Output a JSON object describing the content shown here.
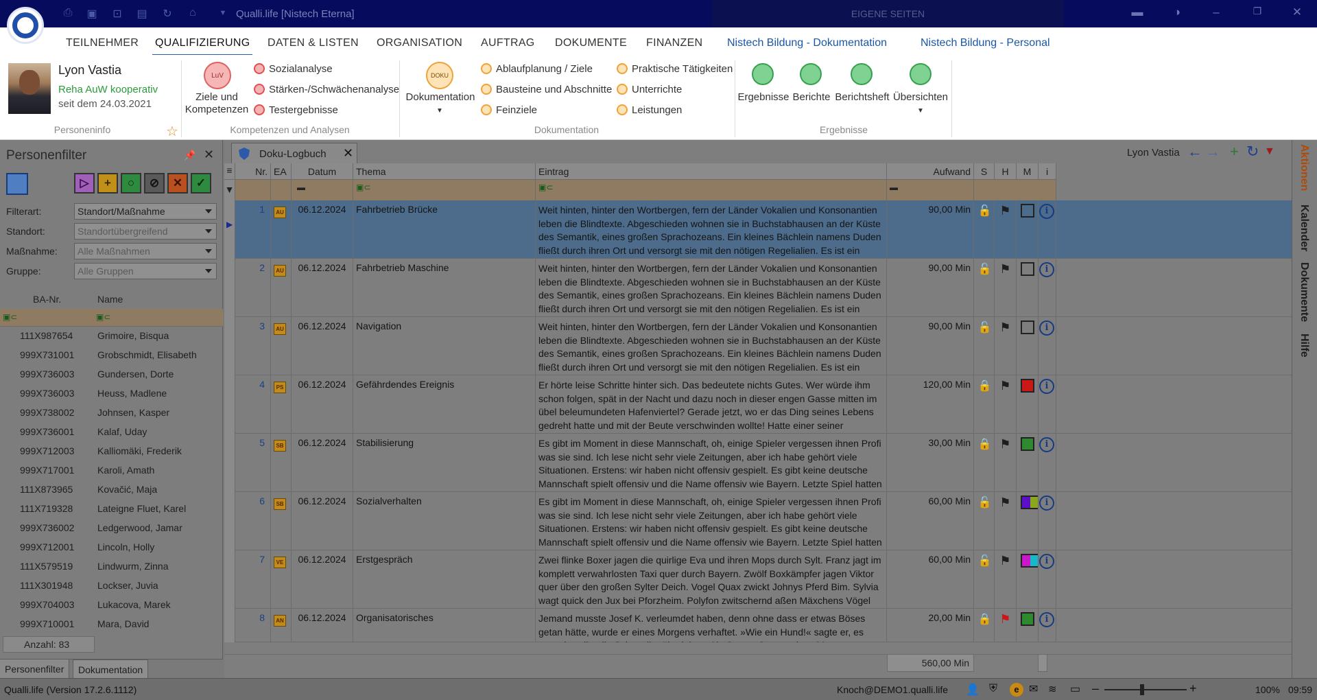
{
  "titlebar": {
    "app_title": "Qualli.life [Nistech Eterna]",
    "own_pages": "EIGENE SEITEN",
    "quick_access_icons": [
      "print-icon",
      "save-icon",
      "lock-icon",
      "document-settings-icon",
      "refresh-icon",
      "home-icon",
      "dropdown-icon"
    ],
    "window_buttons": [
      "layout-icon",
      "contrast-icon",
      "minimize-icon",
      "restore-icon",
      "close-icon"
    ]
  },
  "menu": {
    "items": [
      "TEILNEHMER",
      "QUALIFIZIERUNG",
      "DATEN & LISTEN",
      "ORGANISATION",
      "AUFTRAG",
      "DOKUMENTE",
      "FINANZEN"
    ],
    "links": [
      "Nistech Bildung - Dokumentation",
      "Nistech Bildung - Personal"
    ],
    "active": "QUALIFIZIERUNG"
  },
  "ribbon": {
    "person": {
      "name": "Lyon Vastia",
      "group": "Reha AuW kooperativ",
      "since": "seit dem 24.03.2021",
      "section_label": "Personeninfo"
    },
    "competences": {
      "badge": "LuV",
      "big_label_1": "Ziele und",
      "big_label_2": "Kompetenzen",
      "items": [
        "Sozialanalyse",
        "Stärken-/Schwächenanalyse",
        "Testergebnisse"
      ],
      "section_label": "Kompetenzen und Analysen"
    },
    "documentation": {
      "badge": "DOKU",
      "big_label": "Dokumentation",
      "items_col1": [
        "Ablaufplanung / Ziele",
        "Bausteine und Abschnitte",
        "Feinziele"
      ],
      "items_col2": [
        "Praktische Tätigkeiten",
        "Unterrichte",
        "Leistungen"
      ],
      "section_label": "Dokumentation"
    },
    "results": {
      "items": [
        "Ergebnisse",
        "Berichte",
        "Berichtsheft",
        "Übersichten"
      ],
      "section_label": "Ergebnisse"
    }
  },
  "left_panel": {
    "title": "Personenfilter",
    "filters": [
      {
        "label": "Filterart:",
        "value": "Standort/Maßnahme"
      },
      {
        "label": "Standort:",
        "value": "Standortübergreifend"
      },
      {
        "label": "Maßnahme:",
        "value": "Alle Maßnahmen"
      },
      {
        "label": "Gruppe:",
        "value": "Alle Gruppen"
      }
    ],
    "columns": [
      "BA-Nr.",
      "Name"
    ],
    "rows": [
      {
        "ba": "111X987654",
        "name": "Grimoire, Bisqua"
      },
      {
        "ba": "999X731001",
        "name": "Grobschmidt, Elisabeth"
      },
      {
        "ba": "999X736003",
        "name": "Gundersen, Dorte"
      },
      {
        "ba": "999X736003",
        "name": "Heuss, Madlene"
      },
      {
        "ba": "999X738002",
        "name": "Johnsen, Kasper"
      },
      {
        "ba": "999X736001",
        "name": "Kalaf, Uday"
      },
      {
        "ba": "999X712003",
        "name": "Kalliomäki, Frederik"
      },
      {
        "ba": "999X717001",
        "name": "Karoli, Amath"
      },
      {
        "ba": "111X873965",
        "name": "Kovačić, Maja"
      },
      {
        "ba": "111X719328",
        "name": "Lateigne Fluet, Karel"
      },
      {
        "ba": "999X736002",
        "name": "Ledgerwood, Jamar"
      },
      {
        "ba": "999X712001",
        "name": "Lincoln, Holly"
      },
      {
        "ba": "111X579519",
        "name": "Lindwurm, Zinna"
      },
      {
        "ba": "111X301948",
        "name": "Lockser, Juvia"
      },
      {
        "ba": "999X704003",
        "name": "Lukacova, Marek"
      },
      {
        "ba": "999X710001",
        "name": "Mara, David"
      }
    ],
    "count": "Anzahl: 83",
    "tabs": [
      "Personenfilter",
      "Dokumentation"
    ]
  },
  "main": {
    "tab_title": "Doku-Logbuch",
    "person": "Lyon Vastia",
    "columns": {
      "nr": "Nr.",
      "ea": "EA",
      "datum": "Datum",
      "thema": "Thema",
      "eintrag": "Eintrag",
      "aufwand": "Aufwand",
      "s": "S",
      "h": "H",
      "m": "M",
      "i": "i"
    },
    "rows": [
      {
        "nr": "1",
        "ea": "AU",
        "datum": "06.12.2024",
        "thema": "Fahrbetrieb Brücke",
        "eintrag": "Weit hinten, hinter den Wortbergen, fern der Länder Vokalien und Konsonantien leben die Blindtexte. Abgeschieden wohnen sie in Buchstabhausen an der Küste des Semantik, eines großen Sprachozeans. Ein kleines Bächlein namens Duden fließt durch ihren Ort und versorgt sie mit den nötigen Regelialien. Es ist ein paradiesmatisches Land, in dem",
        "aufwand": "90,00 Min",
        "lock": "open",
        "flag": "black",
        "m": "empty"
      },
      {
        "nr": "2",
        "ea": "AU",
        "datum": "06.12.2024",
        "thema": "Fahrbetrieb Maschine",
        "eintrag": "Weit hinten, hinter den Wortbergen, fern der Länder Vokalien und Konsonantien leben die Blindtexte. Abgeschieden wohnen sie in Buchstabhausen an der Küste des Semantik, eines großen Sprachozeans. Ein kleines Bächlein namens Duden fließt durch ihren Ort und versorgt sie mit den nötigen Regelialien. Es ist ein paradiesmatisches Land, in dem",
        "aufwand": "90,00 Min",
        "lock": "open",
        "flag": "black",
        "m": "empty"
      },
      {
        "nr": "3",
        "ea": "AU",
        "datum": "06.12.2024",
        "thema": "Navigation",
        "eintrag": "Weit hinten, hinter den Wortbergen, fern der Länder Vokalien und Konsonantien leben die Blindtexte. Abgeschieden wohnen sie in Buchstabhausen an der Küste des Semantik, eines großen Sprachozeans. Ein kleines Bächlein namens Duden fließt durch ihren Ort und versorgt sie mit den nötigen Regelialien. Es ist ein paradiesmatisches Land, in dem",
        "aufwand": "90,00 Min",
        "lock": "open",
        "flag": "black",
        "m": "empty"
      },
      {
        "nr": "4",
        "ea": "PS",
        "datum": "06.12.2024",
        "thema": "Gefährdendes Ereignis",
        "eintrag": "Er hörte leise Schritte hinter sich. Das bedeutete nichts Gutes. Wer würde ihm schon folgen, spät in der Nacht und dazu noch in dieser engen Gasse mitten im übel beleumundeten Hafenviertel? Gerade jetzt, wo er das Ding seines Lebens gedreht hatte und mit der Beute verschwinden wollte! Hatte einer seiner",
        "aufwand": "120,00 Min",
        "lock": "red",
        "flag": "black",
        "m": "red"
      },
      {
        "nr": "5",
        "ea": "SB",
        "datum": "06.12.2024",
        "thema": "Stabilisierung",
        "eintrag": "Es gibt im Moment in diese Mannschaft, oh, einige Spieler vergessen ihnen Profi was sie sind. Ich lese nicht sehr viele Zeitungen, aber ich habe gehört viele Situationen. Erstens: wir haben nicht offensiv gespielt. Es gibt keine deutsche Mannschaft spielt offensiv und die Name offensiv wie Bayern. Letzte Spiel hatten",
        "aufwand": "30,00 Min",
        "lock": "orange",
        "flag": "black",
        "m": "green"
      },
      {
        "nr": "6",
        "ea": "SB",
        "datum": "06.12.2024",
        "thema": "Sozialverhalten",
        "eintrag": "Es gibt im Moment in diese Mannschaft, oh, einige Spieler vergessen ihnen Profi was sie sind. Ich lese nicht sehr viele Zeitungen, aber ich habe gehört viele Situationen. Erstens: wir haben nicht offensiv gespielt. Es gibt keine deutsche Mannschaft spielt offensiv und die Name offensiv wie Bayern. Letzte Spiel hatten",
        "aufwand": "60,00 Min",
        "lock": "open",
        "flag": "black",
        "m": "purple-olive"
      },
      {
        "nr": "7",
        "ea": "VE",
        "datum": "06.12.2024",
        "thema": "Erstgespräch",
        "eintrag": "Zwei flinke Boxer jagen die quirlige Eva und ihren Mops durch Sylt. Franz jagt im komplett verwahrlosten Taxi quer durch Bayern. Zwölf Boxkämpfer jagen Viktor quer über den großen Sylter Deich. Vogel Quax zwickt Johnys Pferd Bim. Sylvia wagt quick den Jux bei Pforzheim. Polyfon zwitschernd aßen Mäxchens Vögel Rüben,",
        "aufwand": "60,00 Min",
        "lock": "open",
        "flag": "black",
        "m": "magenta-cyan"
      },
      {
        "nr": "8",
        "ea": "AN",
        "datum": "06.12.2024",
        "thema": "Organisatorisches",
        "eintrag": "Jemand musste Josef K. verleumdet haben, denn ohne dass er etwas Böses getan hätte, wurde er eines Morgens verhaftet. »Wie ein Hund!« sagte er, es war, als sollte die Scham ihn überleben. Als Gregor Samsa eines Morgens aus unruhigen Träumen erwachte, fand er sich",
        "aufwand": "20,00 Min",
        "lock": "orange",
        "flag": "red",
        "m": "green"
      }
    ],
    "total": "560,00 Min"
  },
  "right_tabs": [
    "Aktionen",
    "Kalender",
    "Dokumente",
    "Hilfe"
  ],
  "statusbar": {
    "version": "Qualli.life (Version 17.2.6.1112)",
    "user": "Knoch@DEMO1.qualli.life",
    "zoom": "100%",
    "time": "09:59"
  },
  "colors": {
    "accent": "#1f5fb0",
    "title_bg": "#060b5e",
    "filter_row": "#8f7b61",
    "selected_row": "#4d6b8a"
  }
}
